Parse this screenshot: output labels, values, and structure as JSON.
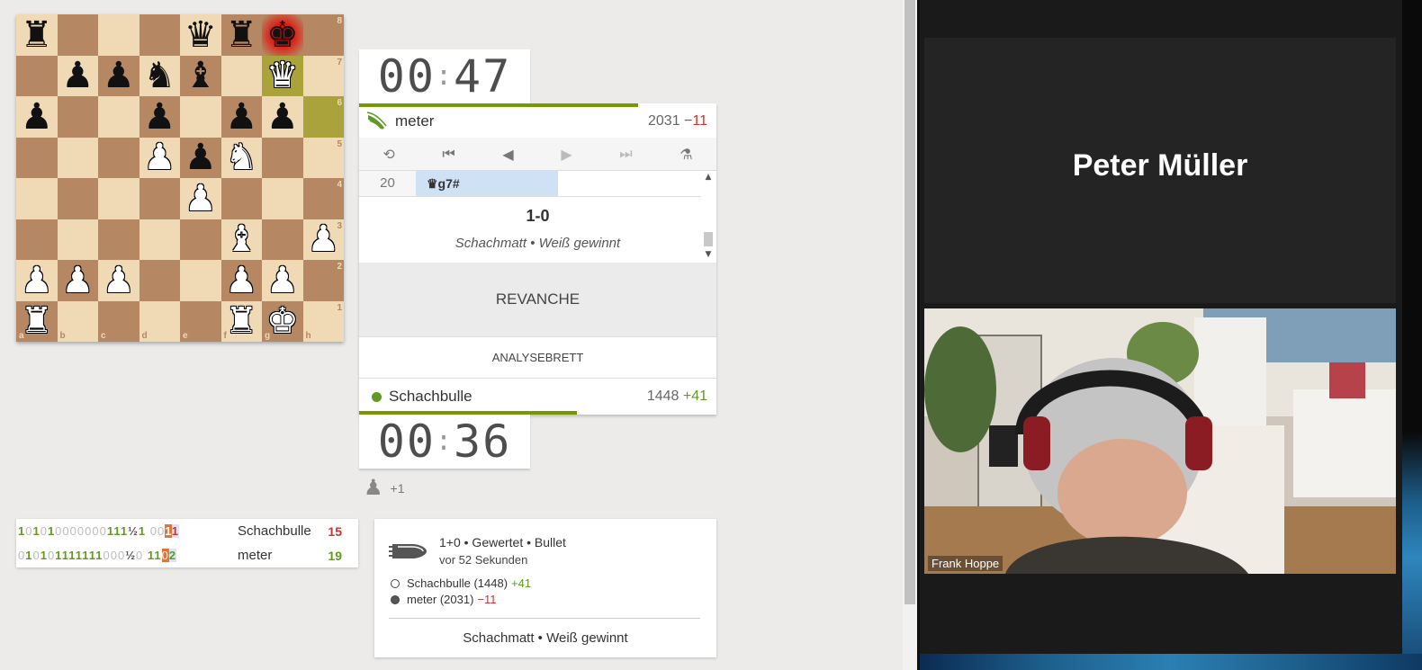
{
  "board": {
    "ranks": [
      "8",
      "7",
      "6",
      "5",
      "4",
      "3",
      "2",
      "1"
    ],
    "files": [
      "a",
      "b",
      "c",
      "d",
      "e",
      "f",
      "g",
      "h"
    ],
    "pieces": [
      {
        "sq": "a8",
        "glyph": "♜",
        "color": "b",
        "name": "black-rook-icon"
      },
      {
        "sq": "e8",
        "glyph": "♛",
        "color": "b",
        "name": "black-queen-icon"
      },
      {
        "sq": "f8",
        "glyph": "♜",
        "color": "b",
        "name": "black-rook-icon"
      },
      {
        "sq": "g8",
        "glyph": "♚",
        "color": "b",
        "name": "black-king-icon"
      },
      {
        "sq": "b7",
        "glyph": "♟",
        "color": "b",
        "name": "black-pawn-icon"
      },
      {
        "sq": "c7",
        "glyph": "♟",
        "color": "b",
        "name": "black-pawn-icon"
      },
      {
        "sq": "d7",
        "glyph": "♞",
        "color": "b",
        "name": "black-knight-icon"
      },
      {
        "sq": "e7",
        "glyph": "♝",
        "color": "b",
        "name": "black-bishop-icon"
      },
      {
        "sq": "g7",
        "glyph": "♛",
        "color": "w",
        "name": "white-queen-icon"
      },
      {
        "sq": "a6",
        "glyph": "♟",
        "color": "b",
        "name": "black-pawn-icon"
      },
      {
        "sq": "d6",
        "glyph": "♟",
        "color": "b",
        "name": "black-pawn-icon"
      },
      {
        "sq": "f6",
        "glyph": "♟",
        "color": "b",
        "name": "black-pawn-icon"
      },
      {
        "sq": "g6",
        "glyph": "♟",
        "color": "b",
        "name": "black-pawn-icon"
      },
      {
        "sq": "d5",
        "glyph": "♟",
        "color": "w",
        "name": "white-pawn-icon"
      },
      {
        "sq": "e5",
        "glyph": "♟",
        "color": "b",
        "name": "black-pawn-icon"
      },
      {
        "sq": "f5",
        "glyph": "♞",
        "color": "w",
        "name": "white-knight-icon"
      },
      {
        "sq": "e4",
        "glyph": "♟",
        "color": "w",
        "name": "white-pawn-icon"
      },
      {
        "sq": "f3",
        "glyph": "♝",
        "color": "w",
        "name": "white-bishop-icon"
      },
      {
        "sq": "h3",
        "glyph": "♟",
        "color": "w",
        "name": "white-pawn-icon"
      },
      {
        "sq": "a2",
        "glyph": "♟",
        "color": "w",
        "name": "white-pawn-icon"
      },
      {
        "sq": "b2",
        "glyph": "♟",
        "color": "w",
        "name": "white-pawn-icon"
      },
      {
        "sq": "c2",
        "glyph": "♟",
        "color": "w",
        "name": "white-pawn-icon"
      },
      {
        "sq": "f2",
        "glyph": "♟",
        "color": "w",
        "name": "white-pawn-icon"
      },
      {
        "sq": "g2",
        "glyph": "♟",
        "color": "w",
        "name": "white-pawn-icon"
      },
      {
        "sq": "a1",
        "glyph": "♜",
        "color": "w",
        "name": "white-rook-icon"
      },
      {
        "sq": "f1",
        "glyph": "♜",
        "color": "w",
        "name": "white-rook-icon"
      },
      {
        "sq": "g1",
        "glyph": "♚",
        "color": "w",
        "name": "white-king-icon"
      }
    ],
    "last_move": [
      "g7",
      "h6"
    ],
    "check": "g8"
  },
  "clock_top": {
    "min": "00",
    "sec": "47",
    "remaining_fraction": 0.78
  },
  "clock_bottom": {
    "min": "00",
    "sec": "36",
    "remaining_fraction": 0.61
  },
  "opponent": {
    "name": "meter",
    "rating": "2031",
    "diff": "−11",
    "icon": "wings-icon"
  },
  "player": {
    "name": "Schachbulle",
    "rating": "1448",
    "diff": "+41",
    "status_color": "#629924"
  },
  "controls": {
    "flip": "flip-board-icon",
    "first": "first-move-icon",
    "prev": "previous-move-icon",
    "next": "next-move-icon",
    "last": "last-move-icon",
    "analysis": "analysis-icon"
  },
  "moves": {
    "number": "20",
    "san": "♛g7#"
  },
  "result": {
    "score": "1-0",
    "status": "Schachmatt • Weiß gewinnt"
  },
  "buttons": {
    "rematch": "REVANCHE",
    "analysis_board": "ANALYSEBRETT"
  },
  "material": {
    "icon": "pawn-icon",
    "diff": "+1"
  },
  "score_table": {
    "rows": [
      {
        "series": [
          "1",
          "0",
          "1",
          "0",
          "1",
          "0",
          "0",
          "0",
          "0",
          "0",
          "0",
          "0",
          "1",
          "1",
          "1",
          "½",
          "1"
        ],
        "recent": [
          "0",
          "0",
          "1",
          "1"
        ],
        "name": "Schachbulle",
        "total": "15",
        "total_color": "#c33"
      },
      {
        "series": [
          "0",
          "1",
          "0",
          "1",
          "0",
          "1",
          "1",
          "1",
          "1",
          "1",
          "1",
          "1",
          "0",
          "0",
          "0",
          "½",
          "0"
        ],
        "recent": [
          "1",
          "1",
          "0",
          "2"
        ],
        "name": "meter",
        "total": "19",
        "total_color": "#629924"
      }
    ]
  },
  "game_info": {
    "header": "1+0 • Gewertet • Bullet",
    "time": "vor 52 Sekunden",
    "icon": "bullet-icon",
    "white": {
      "name": "Schachbulle (1448)",
      "diff": "+41"
    },
    "black": {
      "name": "meter (2031)",
      "diff": "−11"
    },
    "status": "Schachmatt • Weiß gewinnt"
  },
  "video_call": {
    "participant_name": "Peter Müller",
    "video_label": "Frank Hoppe"
  },
  "colors": {
    "accent": "#759900",
    "light_square": "#f0d9b5",
    "dark_square": "#b58863",
    "negative": "#c33",
    "positive": "#629924"
  }
}
